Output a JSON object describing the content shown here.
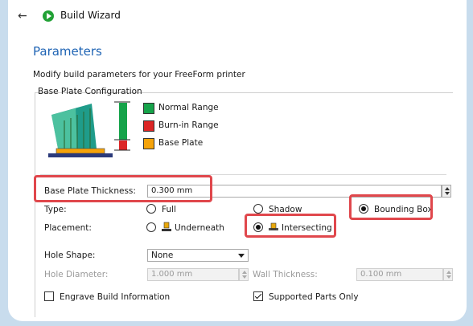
{
  "window": {
    "title": "Build Wizard"
  },
  "page": {
    "heading": "Parameters",
    "subtitle": "Modify build parameters for your FreeForm printer",
    "group_title": "Base Plate Configuration"
  },
  "legend": [
    {
      "label": "Normal Range",
      "color": "#16a34a"
    },
    {
      "label": "Burn-in Range",
      "color": "#dc2626"
    },
    {
      "label": "Base Plate",
      "color": "#f5a30a"
    }
  ],
  "fields": {
    "thickness": {
      "label": "Base Plate Thickness:",
      "value": "0.300 mm"
    },
    "type": {
      "label": "Type:",
      "options": [
        "Full",
        "Shadow",
        "Bounding Box"
      ],
      "selected": "Bounding Box"
    },
    "placement": {
      "label": "Placement:",
      "options": [
        "Underneath",
        "Intersecting"
      ],
      "selected": "Intersecting"
    },
    "hole_shape": {
      "label": "Hole Shape:",
      "value": "None"
    },
    "hole_diameter": {
      "label": "Hole Diameter:",
      "value": "1.000 mm"
    },
    "wall_thickness": {
      "label": "Wall Thickness:",
      "value": "0.100 mm"
    },
    "engrave": {
      "label": "Engrave Build Information",
      "checked": false
    },
    "supported_only": {
      "label": "Supported Parts Only",
      "checked": true
    }
  },
  "colors": {
    "accent": "#1f64b4",
    "highlight": "#e0474c",
    "background": "#c8dced"
  }
}
